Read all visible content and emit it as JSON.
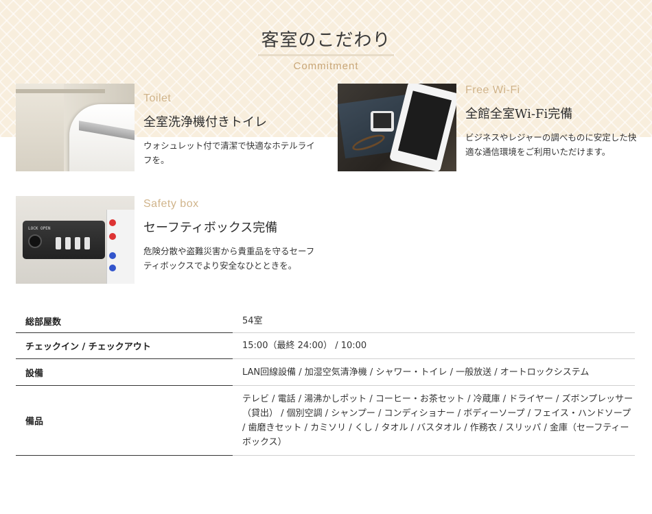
{
  "section": {
    "title": "客室のこだわり",
    "subtitle": "Commitment"
  },
  "features": {
    "toilet": {
      "en": "Toilet",
      "title": "全室洗浄機付きトイレ",
      "desc": "ウォシュレット付で清潔で快適なホテルライフを。"
    },
    "wifi": {
      "en": "Free Wi-Fi",
      "title": "全館全室Wi-Fi完備",
      "desc": "ビジネスやレジャーの調べものに安定した快適な通信環境をご利用いただけます。"
    },
    "safety": {
      "en": "Safety box",
      "title": "セーフティボックス完備",
      "desc": "危険分散や盗難災害から貴重品を守るセーフティボックスでより安全なひとときを。",
      "photo_label": "LOCK OPEN"
    }
  },
  "info": {
    "rows": [
      {
        "label": "総部屋数",
        "value": "54室"
      },
      {
        "label": "チェックイン / チェックアウト",
        "value": "15:00（最終 24:00） / 10:00"
      },
      {
        "label": "設備",
        "value": "LAN回線設備 / 加湿空気清浄機 / シャワー・トイレ / 一般放送 / オートロックシステム"
      },
      {
        "label": "備品",
        "value": "テレビ / 電話 / 湯沸かしポット / コーヒー・お茶セット / 冷蔵庫 / ドライヤー / ズボンプレッサー（貸出） / 個別空調 / シャンプー / コンディショナー / ボディーソープ / フェイス・ハンドソープ / 歯磨きセット / カミソリ / くし / タオル / バスタオル / 作務衣 / スリッパ / 金庫（セーフティーボックス）"
      }
    ]
  },
  "colors": {
    "pattern_bg": "#f8eedd",
    "accent": "#c8a677",
    "text": "#333333"
  }
}
